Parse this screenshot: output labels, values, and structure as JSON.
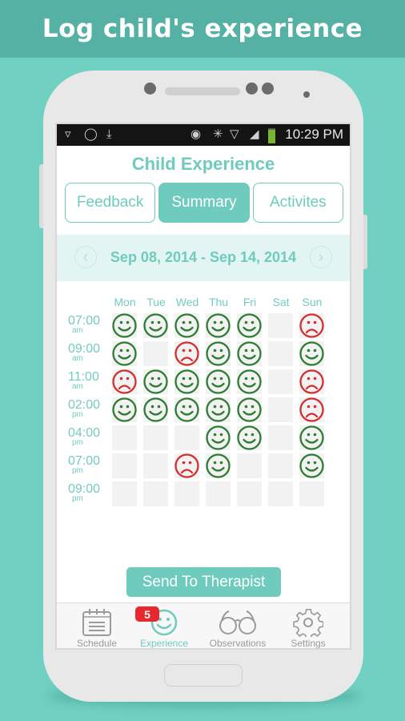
{
  "banner": {
    "title": "Log child's experience"
  },
  "statusbar": {
    "left_icons": [
      "wifi-question-icon",
      "whatsapp-icon",
      "download-icon"
    ],
    "right_icons": [
      "eye-icon",
      "bluetooth-icon",
      "wifi-icon",
      "signal-icon",
      "battery-icon"
    ],
    "time": "10:29 PM"
  },
  "screen": {
    "title": "Child Experience"
  },
  "tabs": [
    {
      "label": "Feedback",
      "active": false
    },
    {
      "label": "Summary",
      "active": true
    },
    {
      "label": "Activites",
      "active": false
    }
  ],
  "week": {
    "range": "Sep 08, 2014 - Sep 14, 2014",
    "prev_icon": "chevron-left-icon",
    "next_icon": "chevron-right-icon"
  },
  "summary": {
    "days": [
      "Mon",
      "Tue",
      "Wed",
      "Thu",
      "Fri",
      "Sat",
      "Sun"
    ],
    "times": [
      {
        "time": "07:00",
        "period": "am",
        "moods": [
          "happy",
          "happy",
          "happy",
          "happy",
          "happy",
          "",
          "sad"
        ]
      },
      {
        "time": "09:00",
        "period": "am",
        "moods": [
          "happy",
          "",
          "sad",
          "happy",
          "happy",
          "",
          "happy"
        ]
      },
      {
        "time": "11:00",
        "period": "am",
        "moods": [
          "sad",
          "happy",
          "happy",
          "happy",
          "happy",
          "",
          "sad"
        ]
      },
      {
        "time": "02:00",
        "period": "pm",
        "moods": [
          "happy",
          "happy",
          "happy",
          "happy",
          "happy",
          "",
          "sad"
        ]
      },
      {
        "time": "04:00",
        "period": "pm",
        "moods": [
          "",
          "",
          "",
          "happy",
          "happy",
          "",
          "happy"
        ]
      },
      {
        "time": "07:00",
        "period": "pm",
        "moods": [
          "",
          "",
          "sad",
          "happy",
          "",
          "",
          "happy"
        ]
      },
      {
        "time": "09:00",
        "period": "pm",
        "moods": [
          "",
          "",
          "",
          "",
          "",
          "",
          ""
        ]
      }
    ],
    "colors": {
      "happy": "#2e7d32",
      "sad": "#d32f2f"
    }
  },
  "actions": {
    "send_label": "Send To Therapist"
  },
  "bottom_nav": {
    "items": [
      {
        "label": "Schedule",
        "icon": "calendar-icon",
        "active": false
      },
      {
        "label": "Experience",
        "icon": "smiley-icon",
        "active": true,
        "badge": "5"
      },
      {
        "label": "Observations",
        "icon": "glasses-icon",
        "active": false
      },
      {
        "label": "Settings",
        "icon": "gear-icon",
        "active": false
      }
    ]
  },
  "theme": {
    "accent": "#6ecbbe",
    "banner": "#54b1a4",
    "background": "#70d1c2"
  }
}
